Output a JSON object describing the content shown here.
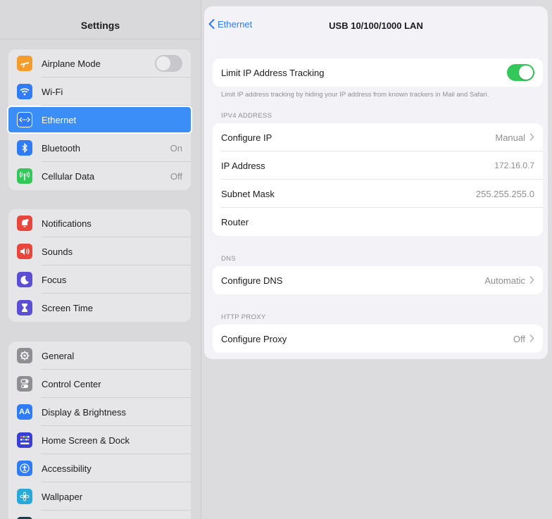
{
  "sidebar": {
    "title": "Settings",
    "groups": [
      {
        "items": [
          {
            "label": "Airplane Mode",
            "icon": "airplane-icon",
            "color": "#f39c2b",
            "control": "toggle-off"
          },
          {
            "label": "Wi-Fi",
            "icon": "wifi-icon",
            "color": "#2f7cf6"
          },
          {
            "label": "Ethernet",
            "icon": "ethernet-icon",
            "color": "#2f7cf6",
            "selected": true
          },
          {
            "label": "Bluetooth",
            "icon": "bluetooth-icon",
            "color": "#2f7cf6",
            "value": "On"
          },
          {
            "label": "Cellular Data",
            "icon": "cellular-icon",
            "color": "#34c759",
            "value": "Off"
          }
        ]
      },
      {
        "items": [
          {
            "label": "Notifications",
            "icon": "notifications-icon",
            "color": "#e8453c"
          },
          {
            "label": "Sounds",
            "icon": "sounds-icon",
            "color": "#e8453c"
          },
          {
            "label": "Focus",
            "icon": "focus-moon-icon",
            "color": "#5b4fd6"
          },
          {
            "label": "Screen Time",
            "icon": "hourglass-icon",
            "color": "#5b4fd6"
          }
        ]
      },
      {
        "items": [
          {
            "label": "General",
            "icon": "gear-icon",
            "color": "#8e8e93"
          },
          {
            "label": "Control Center",
            "icon": "control-center-icon",
            "color": "#8e8e93"
          },
          {
            "label": "Display & Brightness",
            "icon": "display-icon",
            "color": "#2f7cf6"
          },
          {
            "label": "Home Screen & Dock",
            "icon": "home-screen-icon",
            "color": "#3a3fd4"
          },
          {
            "label": "Accessibility",
            "icon": "accessibility-icon",
            "color": "#2f7cf6"
          },
          {
            "label": "Wallpaper",
            "icon": "wallpaper-icon",
            "color": "#2aa8d8"
          }
        ]
      }
    ]
  },
  "detail": {
    "back_label": "Ethernet",
    "title": "USB 10/100/1000 LAN",
    "limit_tracking": {
      "label": "Limit IP Address Tracking",
      "enabled": true,
      "footnote": "Limit IP address tracking by hiding your IP address from known trackers in Mail and Safari."
    },
    "ipv4": {
      "header": "IPV4 ADDRESS",
      "rows": [
        {
          "label": "Configure IP",
          "value": "Manual",
          "chevron": true
        },
        {
          "label": "IP Address",
          "value": "172.16.0.7"
        },
        {
          "label": "Subnet Mask",
          "value": "255.255.255.0"
        },
        {
          "label": "Router",
          "value": ""
        }
      ]
    },
    "dns": {
      "header": "DNS",
      "rows": [
        {
          "label": "Configure DNS",
          "value": "Automatic",
          "chevron": true
        }
      ]
    },
    "proxy": {
      "header": "HTTP PROXY",
      "rows": [
        {
          "label": "Configure Proxy",
          "value": "Off",
          "chevron": true
        }
      ]
    }
  }
}
